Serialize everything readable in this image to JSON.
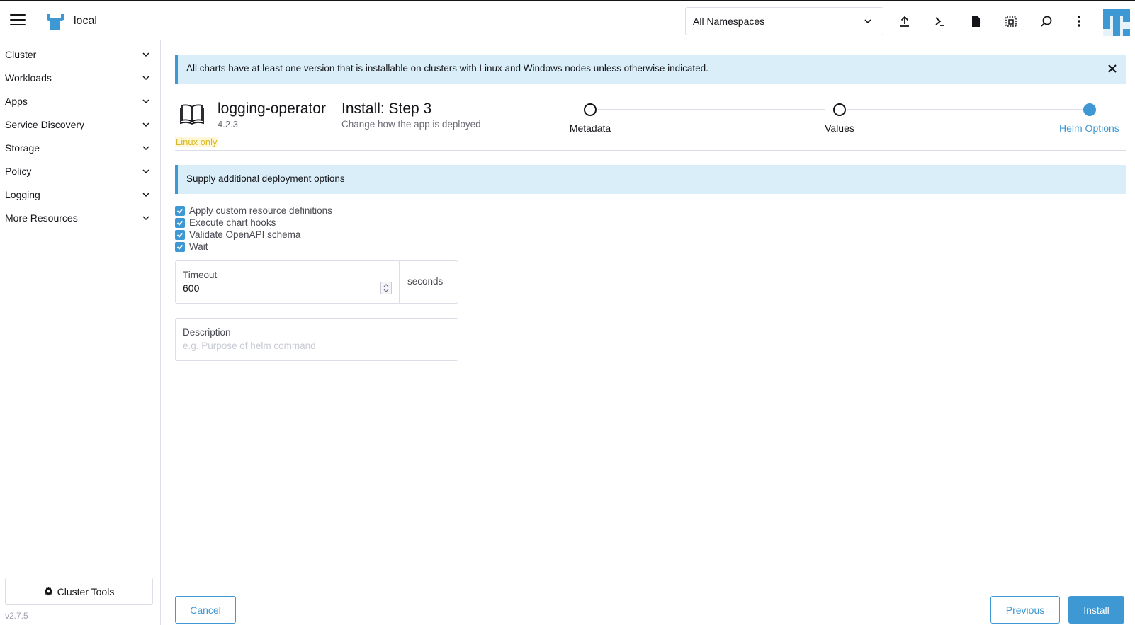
{
  "header": {
    "cluster_name": "local",
    "namespace_select": "All Namespaces"
  },
  "sidebar": {
    "items": [
      {
        "label": "Cluster"
      },
      {
        "label": "Workloads"
      },
      {
        "label": "Apps"
      },
      {
        "label": "Service Discovery"
      },
      {
        "label": "Storage"
      },
      {
        "label": "Policy"
      },
      {
        "label": "Logging"
      },
      {
        "label": "More Resources"
      }
    ],
    "cluster_tools": "Cluster Tools",
    "version": "v2.7.5"
  },
  "banner": {
    "text": "All charts have at least one version that is installable on clusters with Linux and Windows nodes unless otherwise indicated."
  },
  "chart": {
    "name": "logging-operator",
    "version": "4.2.3",
    "badge": "Linux only"
  },
  "step": {
    "title": "Install: Step 3",
    "subtitle": "Change how the app is deployed",
    "steps": [
      {
        "label": "Metadata"
      },
      {
        "label": "Values"
      },
      {
        "label": "Helm Options"
      }
    ]
  },
  "options": {
    "section_title": "Supply additional deployment options",
    "checkboxes": [
      {
        "label": "Apply custom resource definitions",
        "checked": true
      },
      {
        "label": "Execute chart hooks",
        "checked": true
      },
      {
        "label": "Validate OpenAPI schema",
        "checked": true
      },
      {
        "label": "Wait",
        "checked": true
      }
    ],
    "timeout": {
      "label": "Timeout",
      "value": "600",
      "unit": "seconds"
    },
    "description": {
      "label": "Description",
      "placeholder": "e.g. Purpose of helm command"
    }
  },
  "footer": {
    "cancel": "Cancel",
    "previous": "Previous",
    "install": "Install"
  },
  "colors": {
    "accent": "#3d98d3",
    "banner_bg": "#d9eef8",
    "badge_text": "#d8b820"
  }
}
